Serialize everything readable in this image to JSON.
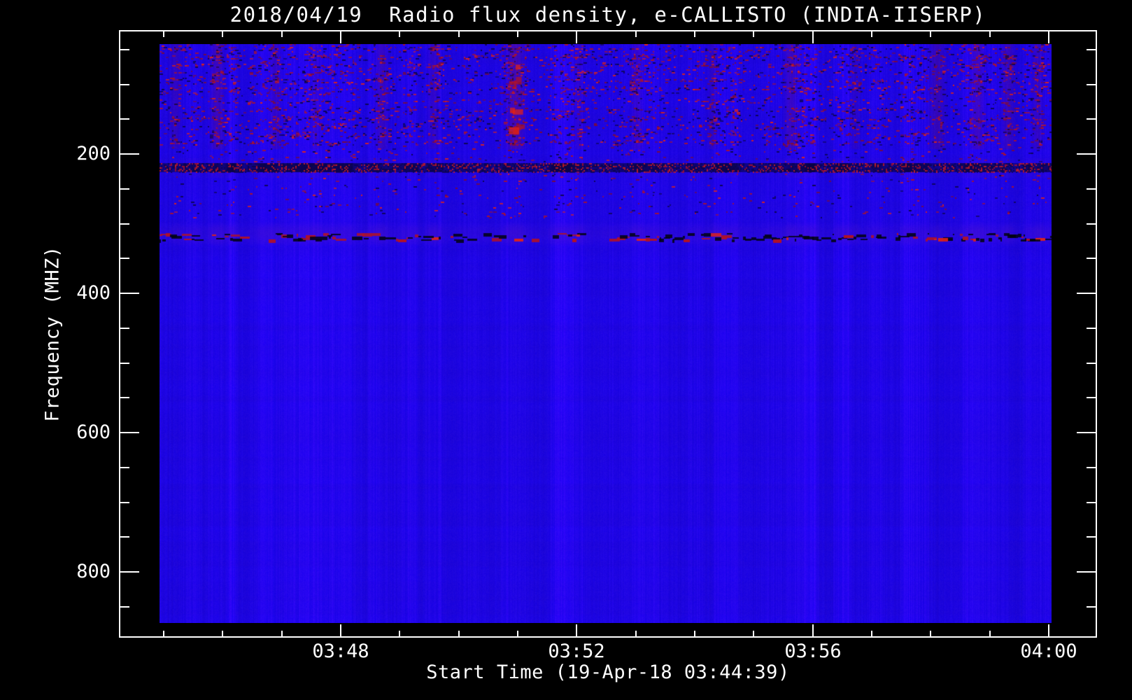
{
  "chart_data": {
    "type": "heatmap",
    "title": "2018/04/19  Radio flux density, e-CALLISTO (INDIA-IISERP)",
    "xlabel": "Start Time (19-Apr-18 03:44:39)",
    "ylabel": "Frequency (MHZ)",
    "x_axis": {
      "start_time": "03:44:39",
      "major_ticks": [
        "03:48",
        "03:52",
        "03:56",
        "04:00"
      ],
      "minor_tick_interval_minutes": 1,
      "ticks_inward": true
    },
    "y_axis": {
      "unit": "MHZ",
      "major_ticks": [
        200,
        400,
        600,
        800
      ],
      "minor_tick_step": 50,
      "range": [
        45,
        870
      ],
      "direction": "increasing-downward"
    },
    "legend": "none",
    "grid": false,
    "colors": {
      "background": "#000000",
      "axis": "#ffffff",
      "text": "#ffffff",
      "base_blue": "#2106e2",
      "speckle_bright": "#e02218",
      "speckle_red": "#b01226",
      "speckle_dark_red": "#7a0a3a",
      "speckle_dark": "#0c0448",
      "haze_purple": "#5a18c0",
      "interference_dark": "#01030f",
      "streak_red": "#b51414"
    },
    "features": {
      "description": "blue spectrogram; RFI speckle bands at low frequencies, dark interference band near 220 MHz, bright red interference band near 320 MHz, quiet uniform blue below ~350 MHz",
      "noise_bands": [
        {
          "freq_range": [
            42,
            108
          ],
          "density": 0.4,
          "style": "speckle",
          "diagonal": true
        },
        {
          "freq_range": [
            108,
            138
          ],
          "density": 0.2,
          "style": "speckle",
          "diagonal": false
        },
        {
          "freq_range": [
            138,
            188
          ],
          "density": 0.36,
          "style": "speckle",
          "diagonal": true
        },
        {
          "freq_range": [
            188,
            212
          ],
          "density": 0.09,
          "style": "speckle",
          "diagonal": false
        },
        {
          "freq_range": [
            213,
            226
          ],
          "density": 0.5,
          "style": "dark_interference",
          "diagonal": false
        },
        {
          "freq_range": [
            228,
            292
          ],
          "density": 0.05,
          "style": "speckle",
          "diagonal": false
        },
        {
          "freq_range": [
            296,
            333
          ],
          "density": 0.3,
          "style": "haze",
          "diagonal": false
        },
        {
          "freq_range": [
            314,
            327
          ],
          "density": 0.55,
          "style": "bright_interference",
          "diagonal": false
        }
      ],
      "vertical_streaks": [
        {
          "t": 0.018,
          "width": 0.006,
          "strength": 0.55
        },
        {
          "t": 0.065,
          "width": 0.007,
          "strength": 0.85
        },
        {
          "t": 0.13,
          "width": 0.006,
          "strength": 0.6
        },
        {
          "t": 0.175,
          "width": 0.005,
          "strength": 0.4
        },
        {
          "t": 0.249,
          "width": 0.007,
          "strength": 0.65
        },
        {
          "t": 0.307,
          "width": 0.006,
          "strength": 0.55
        },
        {
          "t": 0.399,
          "width": 0.009,
          "strength": 1.0
        },
        {
          "t": 0.47,
          "width": 0.005,
          "strength": 0.4
        },
        {
          "t": 0.535,
          "width": 0.006,
          "strength": 0.55
        },
        {
          "t": 0.62,
          "width": 0.005,
          "strength": 0.45
        },
        {
          "t": 0.708,
          "width": 0.007,
          "strength": 0.75
        },
        {
          "t": 0.78,
          "width": 0.005,
          "strength": 0.4
        },
        {
          "t": 0.872,
          "width": 0.008,
          "strength": 0.7
        },
        {
          "t": 0.917,
          "width": 0.007,
          "strength": 0.75
        },
        {
          "t": 0.952,
          "width": 0.007,
          "strength": 0.7
        },
        {
          "t": 0.985,
          "width": 0.006,
          "strength": 0.6
        }
      ]
    }
  }
}
